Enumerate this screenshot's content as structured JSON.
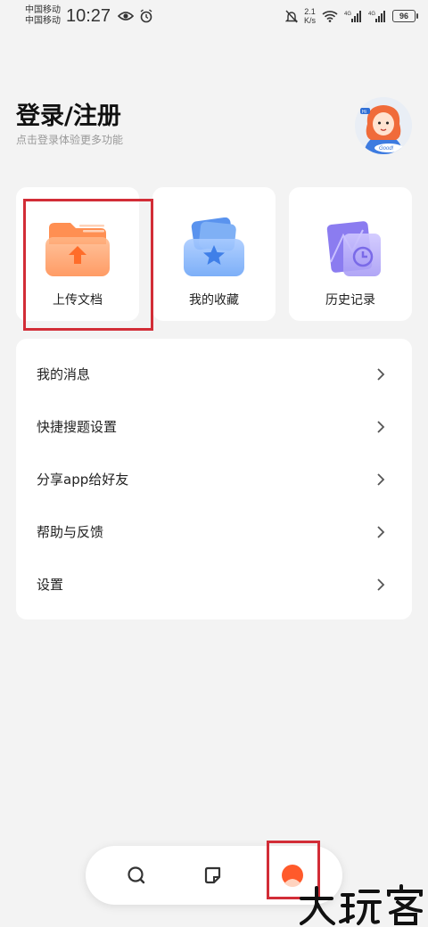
{
  "status_bar": {
    "carrier_1": "中国移动",
    "carrier_2": "中国移动",
    "time": "10:27",
    "net_speed_value": "2.1",
    "net_speed_unit": "K/s",
    "battery": "96",
    "icons": [
      "eye-icon",
      "alarm-icon",
      "mute-bell-icon",
      "wifi-icon",
      "signal-4g-icon",
      "signal-4g-icon",
      "battery-icon"
    ]
  },
  "header": {
    "title": "登录/注册",
    "subtitle": "点击登录体验更多功能"
  },
  "cards": [
    {
      "label": "上传文档",
      "icon": "upload-folder-icon"
    },
    {
      "label": "我的收藏",
      "icon": "favorites-folder-icon"
    },
    {
      "label": "历史记录",
      "icon": "history-clock-icon"
    }
  ],
  "menu": {
    "items": [
      {
        "label": "我的消息"
      },
      {
        "label": "快捷搜题设置"
      },
      {
        "label": "分享app给好友"
      },
      {
        "label": "帮助与反馈"
      },
      {
        "label": "设置"
      }
    ]
  },
  "bottom_nav": {
    "items": [
      "search-icon",
      "notes-icon",
      "profile-icon"
    ],
    "active": "profile-icon"
  },
  "colors": {
    "accent": "#ff5a2b",
    "highlight_border": "#d22d37",
    "background": "#f3f3f3"
  }
}
